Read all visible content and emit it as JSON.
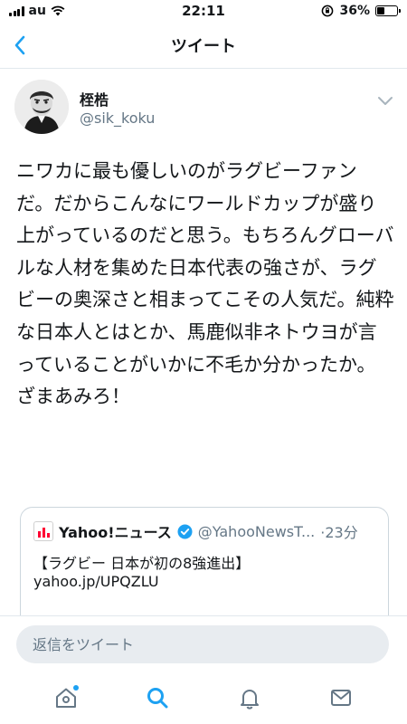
{
  "status_bar": {
    "carrier": "au",
    "time": "22:11",
    "battery_text": "36%",
    "battery_level": 0.36
  },
  "nav": {
    "title": "ツイート"
  },
  "tweet": {
    "display_name": "桎梏",
    "handle": "@sik_koku",
    "text": "ニワカに最も優しいのがラグビーファンだ。だからこんなにワールドカップが盛り上がっているのだと思う。もちろんグローバルな人材を集めた日本代表の強さが、ラグビーの奥深さと相まってこその人気だ。純粋な日本人とはとか、馬鹿似非ネトウヨが言っていることがいかに不毛か分かったか。ざまあみろ！"
  },
  "quoted_tweet": {
    "display_name": "Yahoo!ニュース",
    "handle": "@YahooNewsT...",
    "time": "·23分",
    "line1": "【ラグビー 日本が初の8強進出】",
    "line2": "yahoo.jp/UPQZLU"
  },
  "reply": {
    "placeholder": "返信をツイート"
  },
  "tab_bar": {
    "items": [
      {
        "icon": "home-icon",
        "active": false,
        "badge": true
      },
      {
        "icon": "search-icon",
        "active": true,
        "badge": false
      },
      {
        "icon": "bell-icon",
        "active": false,
        "badge": false
      },
      {
        "icon": "mail-icon",
        "active": false,
        "badge": false
      }
    ]
  },
  "colors": {
    "accent": "#1da1f2",
    "text": "#14171a",
    "secondary_text": "#657786",
    "border": "#e1e8ed"
  }
}
